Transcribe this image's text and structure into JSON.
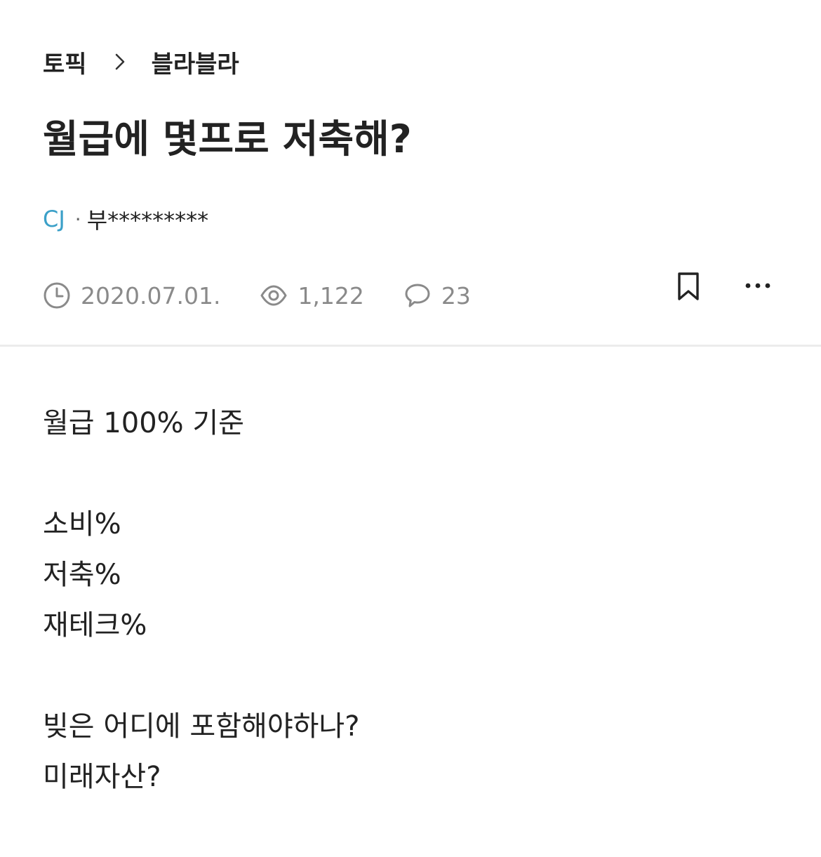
{
  "breadcrumb": {
    "items": [
      "토픽",
      "블라블라"
    ],
    "separator_icon": "chevron-right-icon"
  },
  "post": {
    "title": "월급에 몇프로 저축해?",
    "company": "CJ",
    "dot": "·",
    "nickname": "부*********",
    "date": "2020.07.01.",
    "views": "1,122",
    "comments": "23",
    "body_lines": [
      "월급 100% 기준",
      "",
      "소비%",
      "저축%",
      "재테크%",
      "",
      "빚은 어디에 포함해야하나?",
      "미래자산?"
    ]
  },
  "icons": {
    "date": "clock-icon",
    "views": "eye-icon",
    "comments": "speech-bubble-icon",
    "bookmark": "bookmark-icon",
    "more": "more-dots-icon"
  },
  "colors": {
    "text": "#222222",
    "meta": "#8a8a8a",
    "company": "#3ba0c8",
    "divider": "#ececec"
  }
}
